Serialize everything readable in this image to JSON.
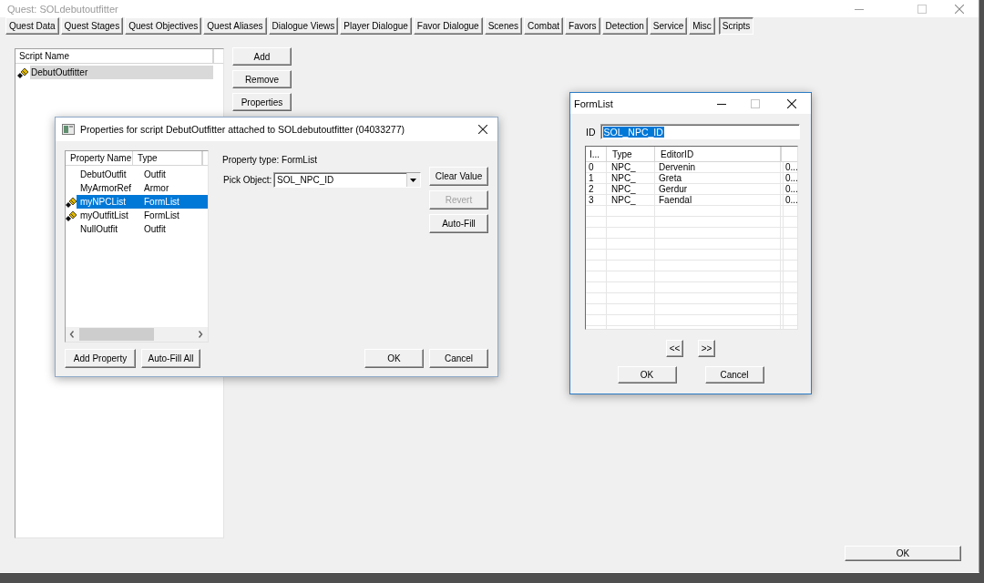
{
  "window": {
    "title": "Quest: SOLdebutoutfitter"
  },
  "tabs": [
    {
      "label": "Quest Data",
      "selected": false
    },
    {
      "label": "Quest Stages",
      "selected": false
    },
    {
      "label": "Quest Objectives",
      "selected": false
    },
    {
      "label": "Quest Aliases",
      "selected": false
    },
    {
      "label": "Dialogue Views",
      "selected": false
    },
    {
      "label": "Player Dialogue",
      "selected": false
    },
    {
      "label": "Favor Dialogue",
      "selected": false
    },
    {
      "label": "Scenes",
      "selected": false
    },
    {
      "label": "Combat",
      "selected": false
    },
    {
      "label": "Favors",
      "selected": false
    },
    {
      "label": "Detection",
      "selected": false
    },
    {
      "label": "Service",
      "selected": false
    },
    {
      "label": "Misc",
      "selected": false
    },
    {
      "label": "Scripts",
      "selected": true
    }
  ],
  "scripts": {
    "columns": [
      "Script Name"
    ],
    "items": [
      {
        "name": "DebutOutfitter",
        "selected": true
      }
    ]
  },
  "script_buttons": [
    "Add",
    "Remove",
    "Properties"
  ],
  "properties_dialog": {
    "title": "Properties for script DebutOutfitter attached to SOLdebutoutfitter (04033277)",
    "columns": [
      "Property Name",
      "Type"
    ],
    "properties": [
      {
        "name": "DebutOutfit",
        "type": "Outfit",
        "value_set": false,
        "selected": false
      },
      {
        "name": "MyArmorRef",
        "type": "Armor",
        "value_set": false,
        "selected": false
      },
      {
        "name": "myNPCList",
        "type": "FormList",
        "value_set": true,
        "selected": true
      },
      {
        "name": "myOutfitList",
        "type": "FormList",
        "value_set": true,
        "selected": false
      },
      {
        "name": "NullOutfit",
        "type": "Outfit",
        "value_set": false,
        "selected": false
      }
    ],
    "property_type": "Property type: FormList",
    "pick_label": "Pick Object:",
    "pick_value": "SOL_NPC_ID",
    "side_buttons": [
      {
        "label": "Clear Value",
        "disabled": false
      },
      {
        "label": "Revert",
        "disabled": true
      },
      {
        "label": "Auto-Fill",
        "disabled": false
      }
    ],
    "left_buttons": [
      "Add Property",
      "Auto-Fill All"
    ],
    "right_buttons": [
      "OK",
      "Cancel"
    ]
  },
  "formlist_dialog": {
    "title": "FormList",
    "id_label": "ID",
    "id_value": "SOL_NPC_ID",
    "id_highlighted": true,
    "columns": [
      "I...",
      "Type",
      "EditorID"
    ],
    "rows": [
      {
        "index": "0",
        "type": "NPC_",
        "editor_id": "Dervenin",
        "column_4": "0..."
      },
      {
        "index": "1",
        "type": "NPC_",
        "editor_id": "Greta",
        "column_4": "0..."
      },
      {
        "index": "2",
        "type": "NPC_",
        "editor_id": "Gerdur",
        "column_4": "0..."
      },
      {
        "index": "3",
        "type": "NPC_",
        "editor_id": "Faendal",
        "column_4": "0..."
      }
    ],
    "nav_buttons": [
      "<<",
      ">>"
    ],
    "buttons": [
      "OK",
      "Cancel"
    ]
  },
  "ok_button": "OK"
}
